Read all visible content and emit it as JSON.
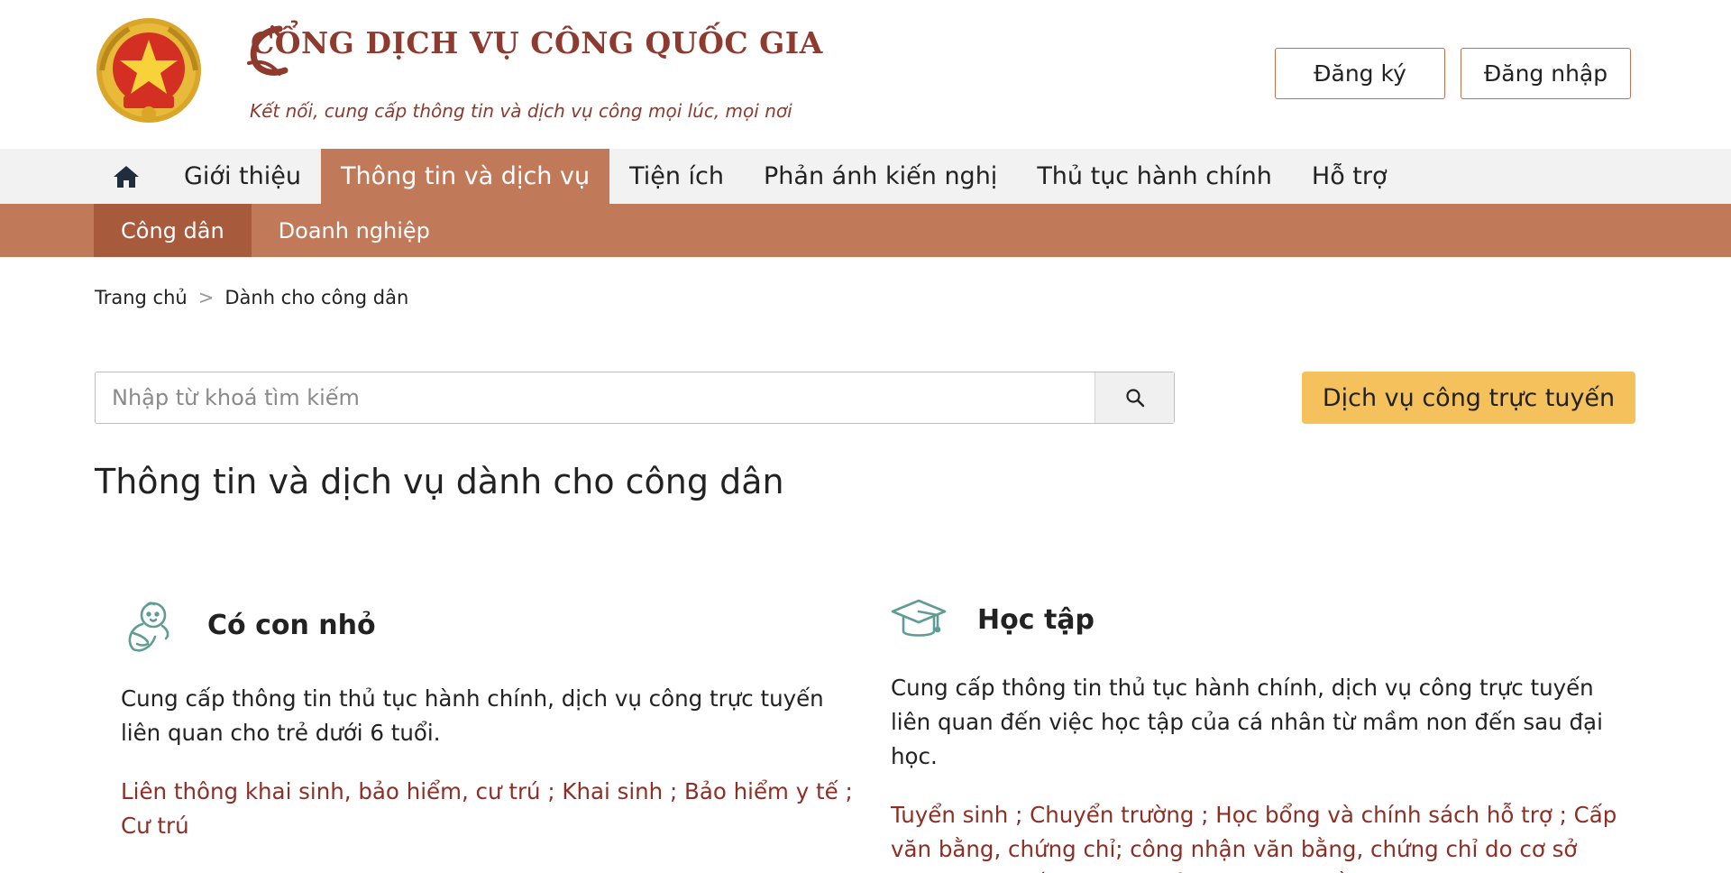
{
  "header": {
    "title": "CỔNG DỊCH VỤ CÔNG QUỐC GIA",
    "slogan": "Kết nối, cung cấp thông tin và dịch vụ công mọi lúc, mọi nơi",
    "register_label": "Đăng ký",
    "login_label": "Đăng nhập"
  },
  "nav": {
    "home_icon": "home-icon",
    "items": [
      {
        "label": "Giới thiệu"
      },
      {
        "label": "Thông tin và dịch vụ",
        "active": true
      },
      {
        "label": "Tiện ích"
      },
      {
        "label": "Phản ánh kiến nghị"
      },
      {
        "label": "Thủ tục hành chính"
      },
      {
        "label": "Hỗ trợ"
      }
    ]
  },
  "subnav": {
    "items": [
      {
        "label": "Công dân",
        "active": true
      },
      {
        "label": "Doanh nghiệp"
      }
    ]
  },
  "breadcrumb": {
    "home": "Trang chủ",
    "separator": ">",
    "current": "Dành cho công dân"
  },
  "search": {
    "placeholder": "Nhập từ khoá tìm kiếm",
    "value": ""
  },
  "online_service_label": "Dịch vụ công trực tuyến",
  "page_title": "Thông tin và dịch vụ dành cho công dân",
  "categories": [
    {
      "icon": "baby-icon",
      "title": "Có con nhỏ",
      "description": "Cung cấp thông tin thủ tục hành chính, dịch vụ công trực tuyến liên quan cho trẻ dưới 6 tuổi.",
      "links_text": "Liên thông khai sinh, bảo hiểm, cư trú ; Khai sinh ; Bảo hiểm y tế ; Cư trú"
    },
    {
      "icon": "graduation-cap-icon",
      "title": "Học tập",
      "description": "Cung cấp thông tin thủ tục hành chính, dịch vụ công trực tuyến liên quan đến việc học tập của cá nhân từ mầm non đến sau đại học.",
      "links_text": "Tuyển sinh ; Chuyển trường ; Học bổng và chính sách hỗ trợ ; Cấp văn bằng, chứng chỉ; công nhận văn bằng, chứng chỉ do cơ sở nước ngoài cấp ; Học tập ở nước ngoài bằng ngân sách nhà nước"
    }
  ],
  "colors": {
    "brand": "#8e3a2e",
    "nav_active": "#c07a5a",
    "subnav_bg": "#c07a5a",
    "subnav_active": "#a85a3c",
    "online_button": "#f5c15c",
    "link": "#8e2f26",
    "icon": "#5f9c93"
  }
}
